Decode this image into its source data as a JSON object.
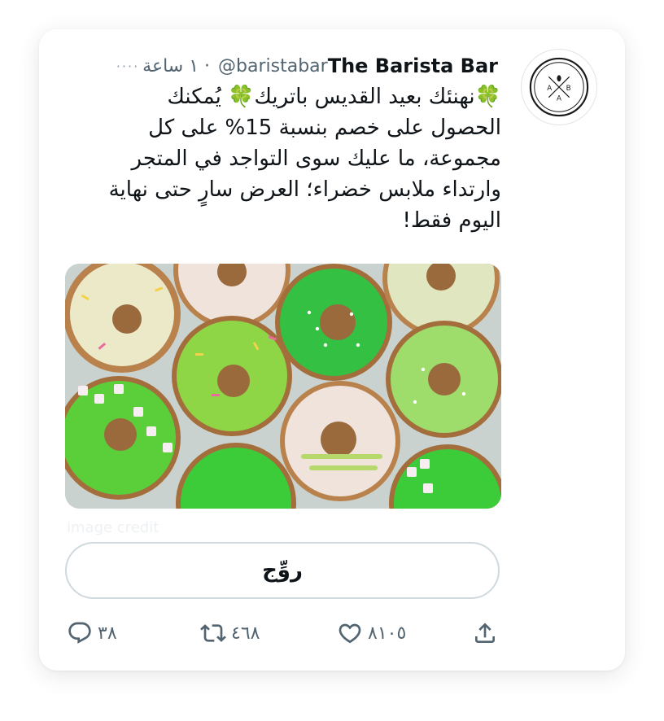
{
  "tweet": {
    "author_name": "The Barista Bar",
    "handle": "@baristabar",
    "time": "١ ساعة",
    "separator": "·",
    "more": "····",
    "lines": [
      "نهنئك بعيد القديس باتريك",
      "يُمكنك",
      "الحصول على خصم بنسبة 15% على كل",
      "مجموعة، ما عليك سوى التواجد في المتجر",
      "وارتداء ملابس خضراء؛ العرض سارٍ حتى نهاية",
      "اليوم فقط!"
    ],
    "clover": "🍀",
    "image_credit": "image credit",
    "button_label": "روِّج"
  },
  "avatar": {
    "letters": [
      "A",
      "B",
      "A"
    ]
  },
  "actions": {
    "reply": "٣٨",
    "retweet": "٤٦٨",
    "like": "٨١٠٥",
    "share": ""
  },
  "colors": {
    "text": "#0f1419",
    "muted": "#536471",
    "border": "#cfd9de",
    "clover": "#2e9b3e"
  }
}
